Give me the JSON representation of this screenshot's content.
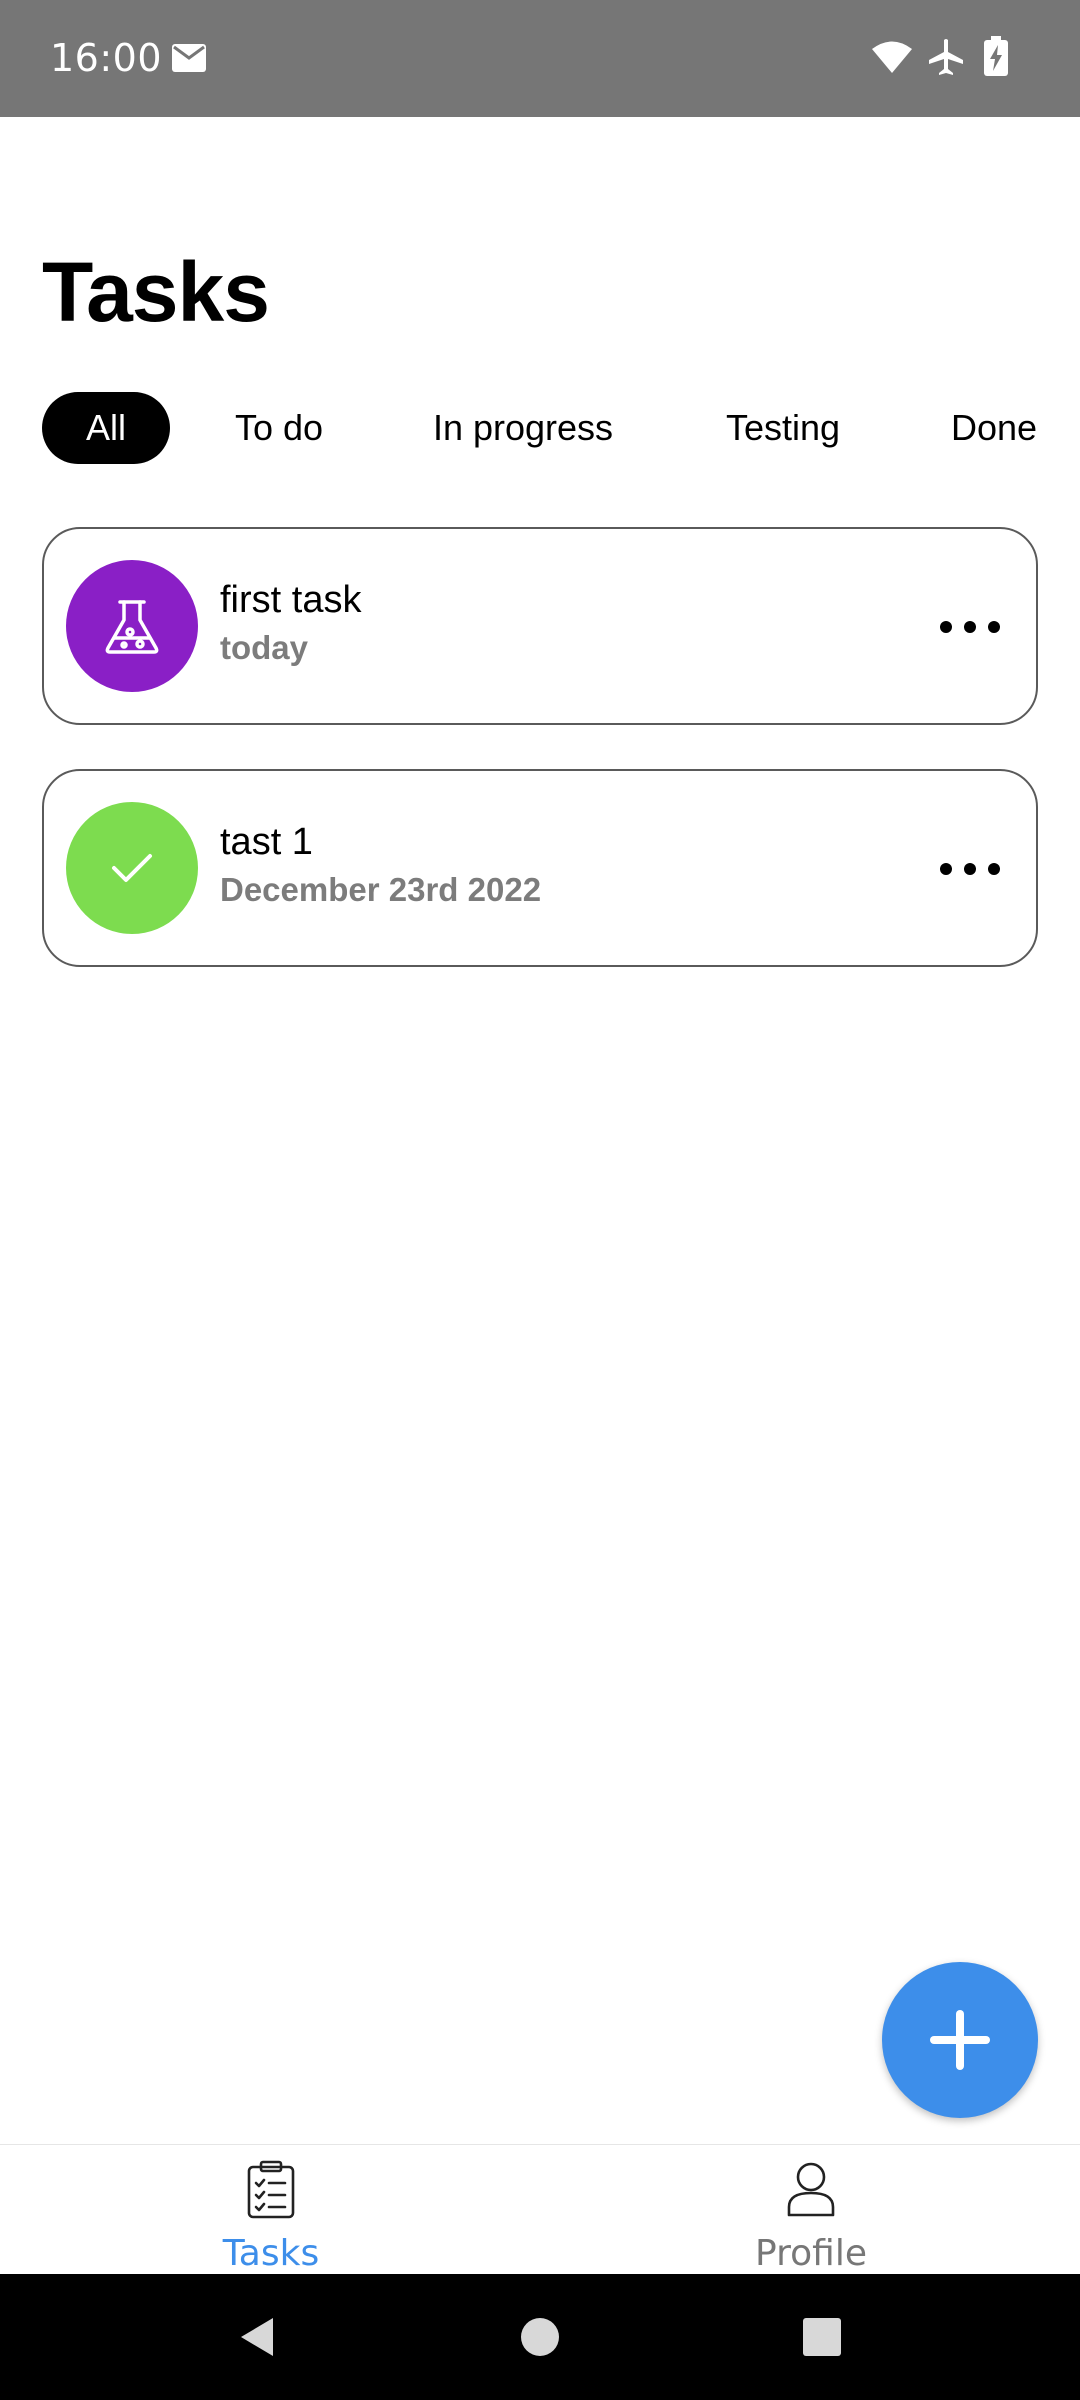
{
  "status_bar": {
    "time": "16:00",
    "icons": [
      "mail-icon",
      "wifi-icon",
      "airplane-mode-icon",
      "battery-charging-icon"
    ]
  },
  "page": {
    "title": "Tasks"
  },
  "filters": {
    "tabs": [
      {
        "label": "All",
        "active": true
      },
      {
        "label": "To do",
        "active": false
      },
      {
        "label": "In progress",
        "active": false
      },
      {
        "label": "Testing",
        "active": false
      },
      {
        "label": "Done",
        "active": false
      }
    ]
  },
  "tasks": [
    {
      "title": "first task",
      "subtitle": "today",
      "icon": "flask-icon",
      "color": "#8a1fc6"
    },
    {
      "title": "tast 1",
      "subtitle": "December 23rd 2022",
      "icon": "check-icon",
      "color": "#7ddc4f"
    }
  ],
  "fab": {
    "icon": "plus-icon",
    "color": "#3d8eea"
  },
  "bottom_nav": {
    "items": [
      {
        "label": "Tasks",
        "icon": "clipboard-checklist-icon",
        "active": true
      },
      {
        "label": "Profile",
        "icon": "user-icon",
        "active": false
      }
    ],
    "active_color": "#3d8eea",
    "inactive_color": "#777777"
  },
  "system_nav": {
    "icons": [
      "back-icon",
      "home-icon",
      "recents-icon"
    ]
  }
}
